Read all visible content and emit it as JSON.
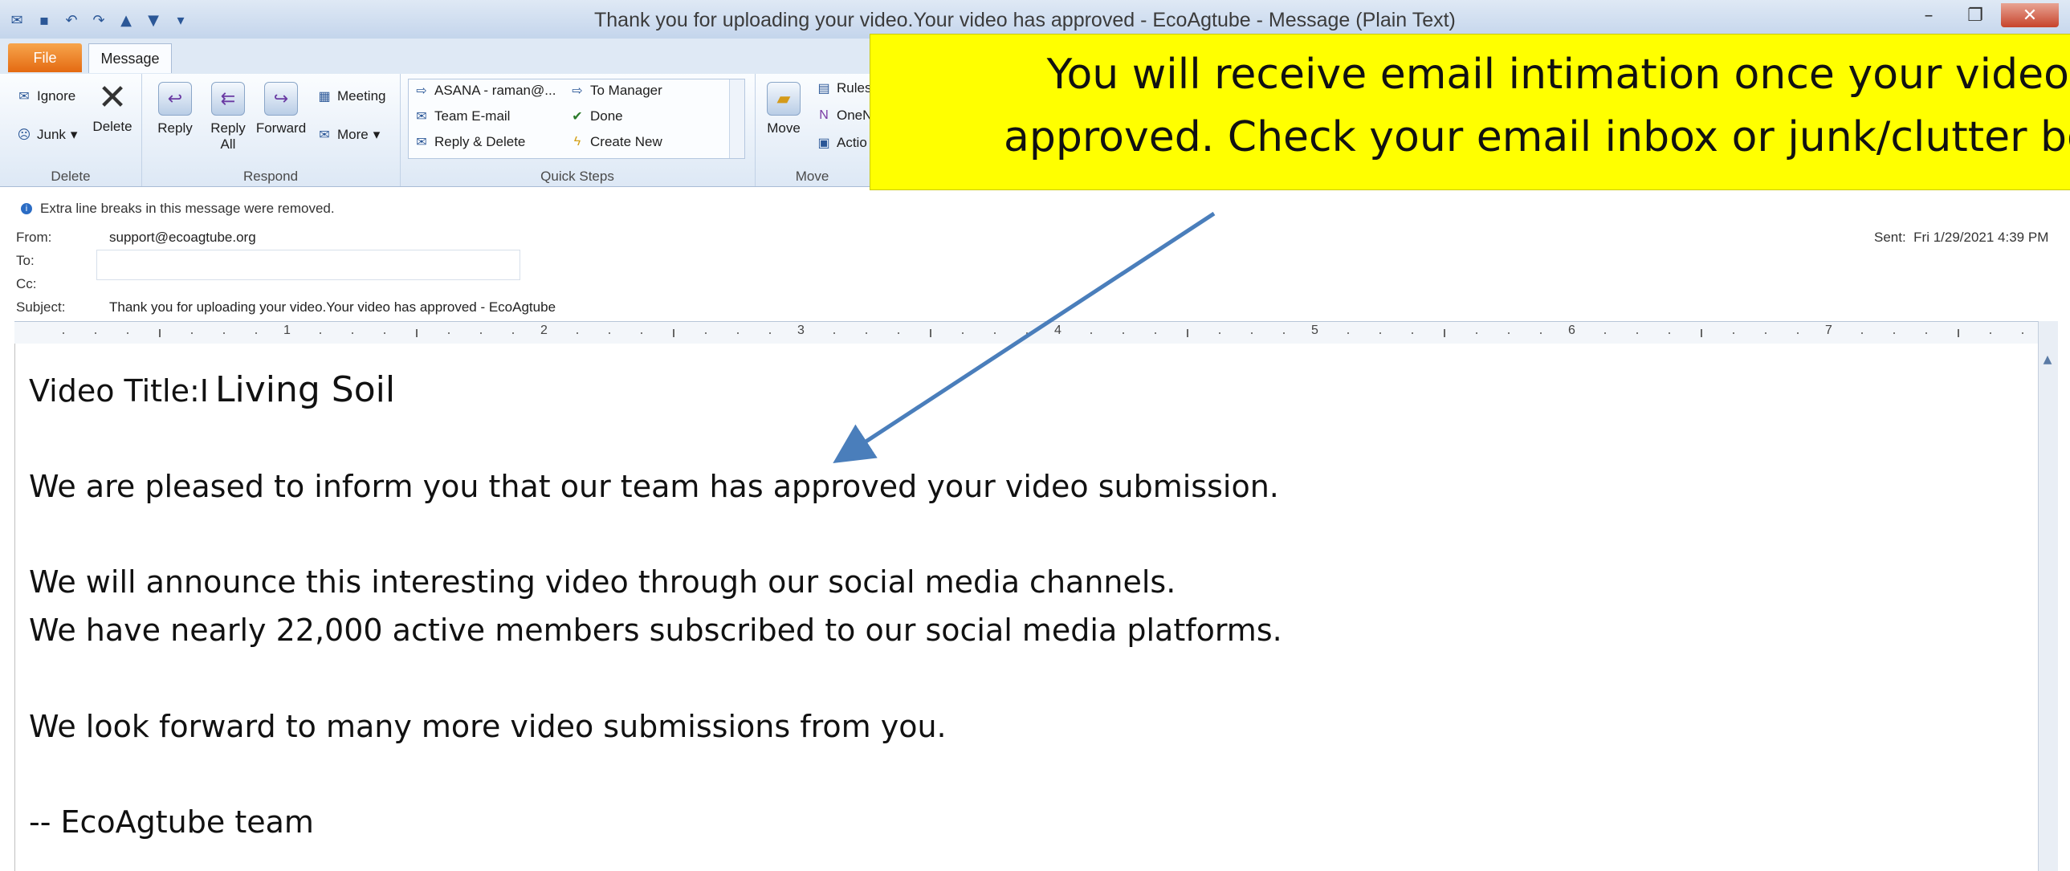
{
  "window": {
    "title": "Thank you for uploading your video.Your video has approved - EcoAgtube  -  Message (Plain Text)",
    "minimize": "–",
    "restore": "❐",
    "close": "✕"
  },
  "tabs": {
    "file": "File",
    "message": "Message"
  },
  "ribbon": {
    "delete_group": {
      "label": "Delete",
      "ignore": "Ignore",
      "junk": "Junk",
      "delete": "Delete"
    },
    "respond_group": {
      "label": "Respond",
      "reply": "Reply",
      "reply_all_line1": "Reply",
      "reply_all_line2": "All",
      "forward": "Forward",
      "meeting": "Meeting",
      "more": "More"
    },
    "quick_steps": {
      "label": "Quick Steps",
      "asana": "ASANA - raman@...",
      "team_email": "Team E-mail",
      "reply_delete": "Reply & Delete",
      "to_manager": "To Manager",
      "done": "Done",
      "create_new": "Create New"
    },
    "move_group": {
      "label": "Move",
      "move": "Move",
      "rules": "Rules",
      "onenote": "OneN",
      "actions": "Actio"
    }
  },
  "callout": {
    "line1": "You will receive email intimation once your video is",
    "line2": "approved. Check your email inbox or junk/clutter box"
  },
  "message": {
    "info": "Extra line breaks in this message were removed.",
    "from_label": "From:",
    "from": "support@ecoagtube.org",
    "to_label": "To:",
    "cc_label": "Cc:",
    "subject_label": "Subject:",
    "subject": "Thank you for uploading your video.Your video has approved - EcoAgtube",
    "sent_label": "Sent:",
    "sent": "Fri 1/29/2021 4:39 PM"
  },
  "ruler": [
    "1",
    "2",
    "3",
    "4",
    "5",
    "6",
    "7"
  ],
  "body": {
    "video_title_label": "Video Title:I",
    "video_title": "Living Soil",
    "p1": "We are pleased to inform you that our team has approved your video submission.",
    "p2a": "We will announce this interesting video through our social media channels.",
    "p2b": "We have nearly 22,000 active members subscribed to our social media platforms.",
    "p3": "We look forward to many more video submissions from you.",
    "sign": "-- EcoAgtube team"
  },
  "colors": {
    "callout": "#ffff00",
    "arrow": "#4a7ebb",
    "file_tab": "#e46a12"
  }
}
